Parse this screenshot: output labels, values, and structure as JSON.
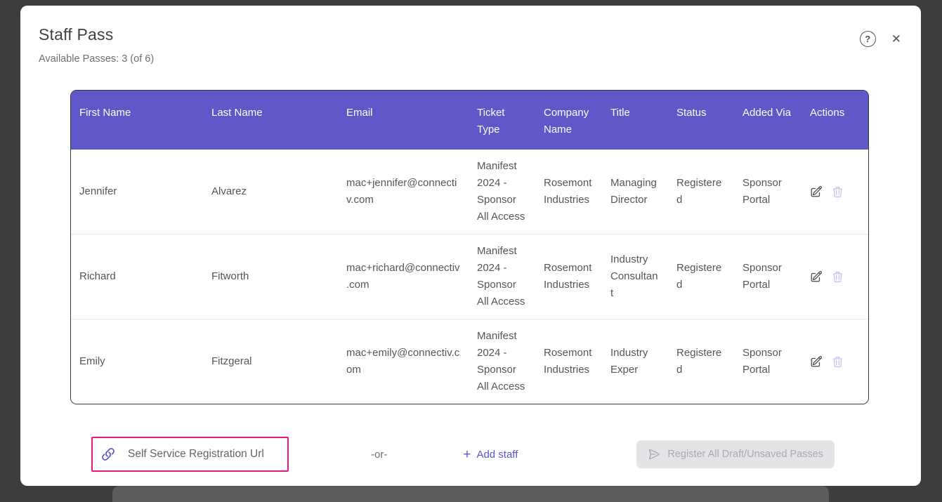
{
  "modal": {
    "title": "Staff Pass",
    "available_passes": "Available Passes: 3 (of 6)",
    "icons": {
      "help": "?",
      "close": "✕"
    }
  },
  "table": {
    "columns": [
      "First Name",
      "Last Name",
      "Email",
      "Ticket Type",
      "Company Name",
      "Title",
      "Status",
      "Added Via",
      "Actions"
    ],
    "rows": [
      {
        "first_name": "Jennifer",
        "last_name": "Alvarez",
        "email": "mac+jennifer@connectiv.com",
        "ticket_type": "Manifest 2024 - Sponsor All Access",
        "company_name": "Rosemont Industries",
        "title": "Managing Director",
        "status": "Registered",
        "added_via": "Sponsor Portal"
      },
      {
        "first_name": "Richard",
        "last_name": "Fitworth",
        "email": "mac+richard@connectiv.com",
        "ticket_type": "Manifest 2024 - Sponsor All Access",
        "company_name": "Rosemont Industries",
        "title": "Industry Consultant",
        "status": "Registered",
        "added_via": "Sponsor Portal"
      },
      {
        "first_name": "Emily",
        "last_name": "Fitzgeral",
        "email": "mac+emily@connectiv.com",
        "ticket_type": "Manifest 2024 - Sponsor All Access",
        "company_name": "Rosemont Industries",
        "title": "Industry Exper",
        "status": "Registered",
        "added_via": "Sponsor Portal"
      }
    ]
  },
  "footer": {
    "self_service_label": "Self Service Registration Url",
    "or_label": "-or-",
    "add_staff_plus": "+",
    "add_staff_label": "Add staff",
    "register_button_label": "Register All Draft/Unsaved Passes"
  },
  "colors": {
    "table_header_bg": "#6057C8",
    "accent_purple": "#5A52C7",
    "highlight_pink": "#E9197B",
    "disabled_button_bg": "#E4E4E7",
    "disabled_button_text": "#A9A9B1",
    "backdrop": "#3D3D3D",
    "body_text": "#55555E"
  }
}
